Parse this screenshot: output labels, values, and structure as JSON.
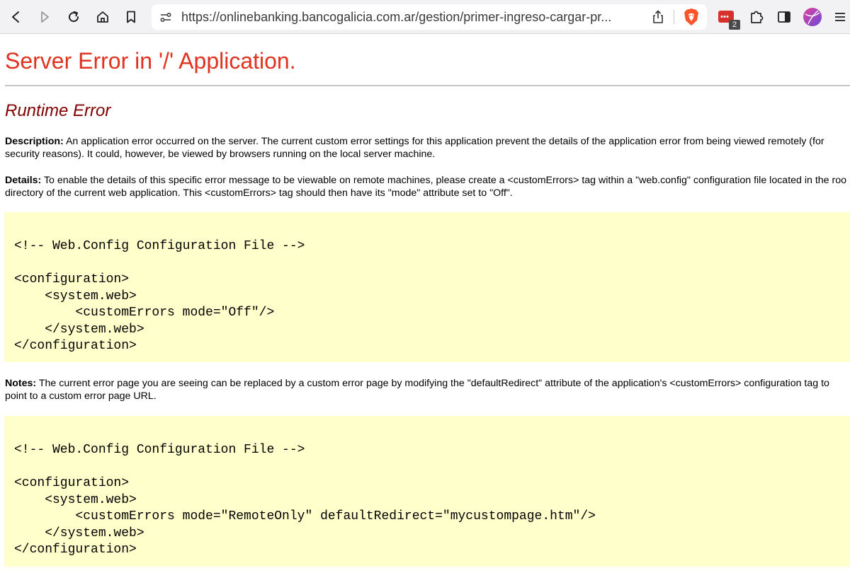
{
  "browser": {
    "url": "https://onlinebanking.bancogalicia.com.ar/gestion/primer-ingreso-cargar-pr...",
    "extension_badge": "2",
    "icons": {
      "back": "back-arrow-icon",
      "forward": "forward-arrow-icon",
      "reload": "reload-icon",
      "home": "home-icon",
      "bookmark": "bookmark-icon",
      "site_settings": "site-settings-icon",
      "share": "share-icon",
      "brave": "brave-shields-icon",
      "extension": "password-extension-icon",
      "extensions": "puzzle-icon",
      "sidebar": "sidebar-icon",
      "profile": "profile-avatar-icon",
      "menu": "hamburger-menu-icon"
    },
    "colors": {
      "toolbar_bg": "#f2f2f4",
      "brave_accent": "#fb542b",
      "extension_red": "#d7312b"
    }
  },
  "page": {
    "title": "Server Error in '/' Application.",
    "subtitle": "Runtime Error",
    "description": {
      "label": "Description:",
      "line1": "An application error occurred on the server. The current custom error settings for this application prevent the details of the application error from being viewed remotely (for",
      "line2": "security reasons). It could, however, be viewed by browsers running on the local server machine."
    },
    "details": {
      "label": "Details:",
      "line1": "To enable the details of this specific error message to be viewable on remote machines, please create a <customErrors> tag within a \"web.config\" configuration file located in the roo",
      "line2": "directory of the current web application. This <customErrors> tag should then have its \"mode\" attribute set to \"Off\"."
    },
    "code1": "<!-- Web.Config Configuration File -->\n\n<configuration>\n    <system.web>\n        <customErrors mode=\"Off\"/>\n    </system.web>\n</configuration>",
    "notes": {
      "label": "Notes:",
      "line1": "The current error page you are seeing can be replaced by a custom error page by modifying the \"defaultRedirect\" attribute of the application's <customErrors> configuration tag to",
      "line2": "point to a custom error page URL."
    },
    "code2": "<!-- Web.Config Configuration File -->\n\n<configuration>\n    <system.web>\n        <customErrors mode=\"RemoteOnly\" defaultRedirect=\"mycustompage.htm\"/>\n    </system.web>\n</configuration>",
    "colors": {
      "title": "#e0331f",
      "subtitle": "#800000",
      "code_bg": "#ffffcc"
    }
  }
}
